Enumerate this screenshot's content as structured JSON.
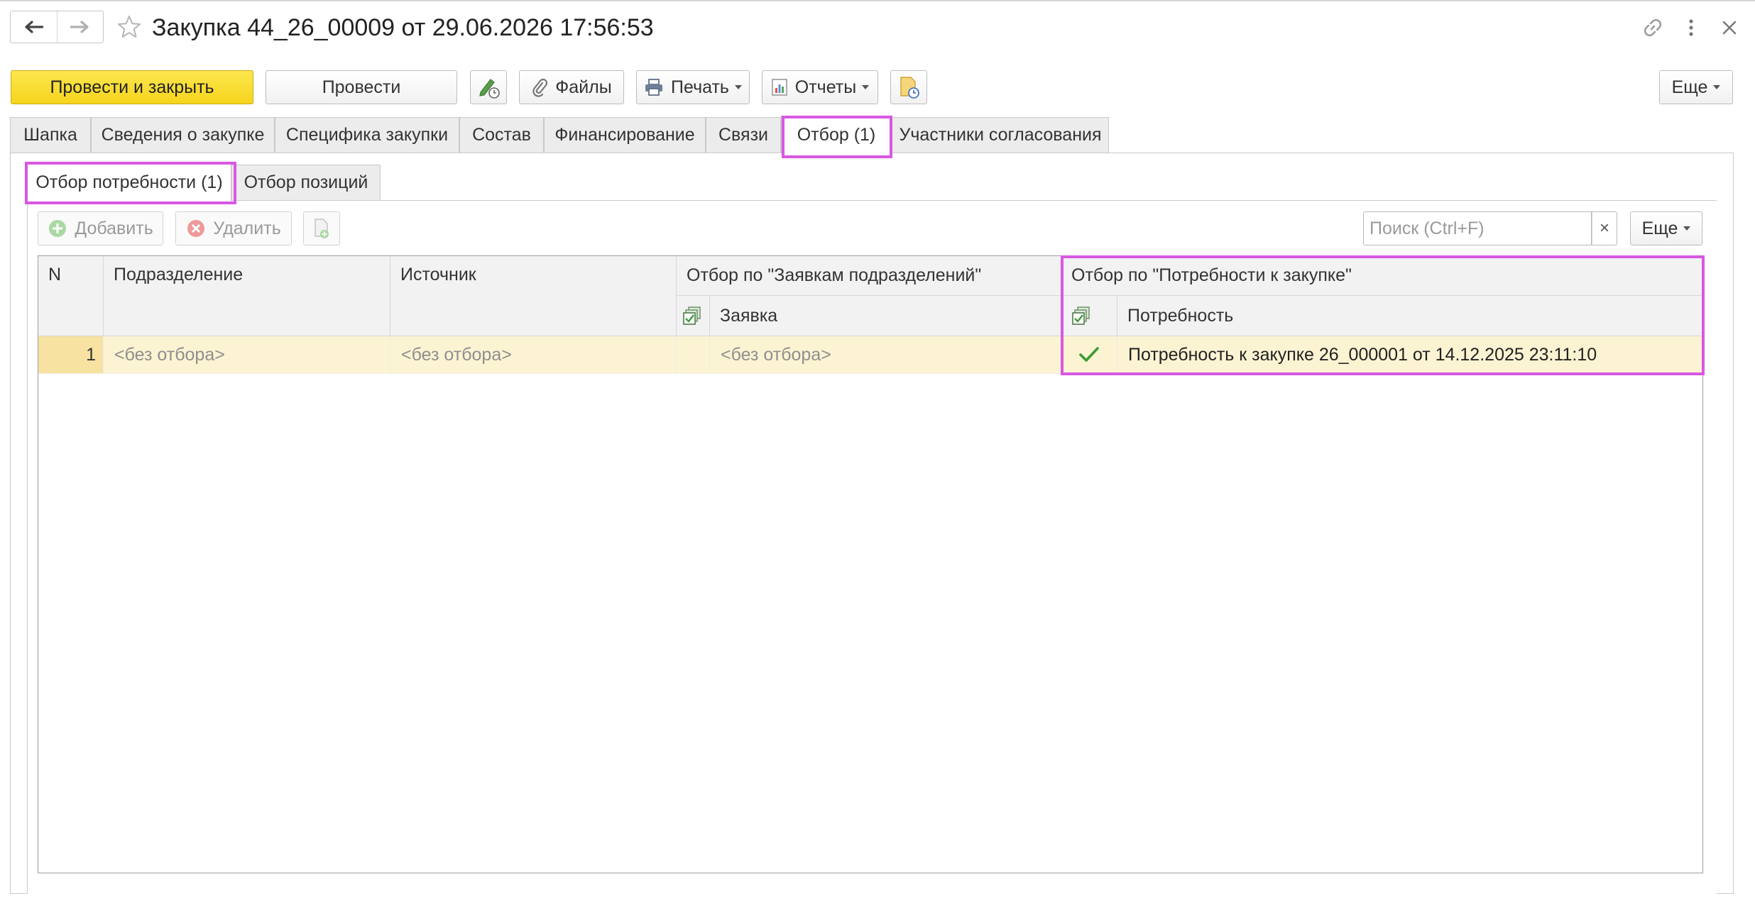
{
  "window": {
    "title": "Закупка 44_26_00009 от 29.06.2026 17:56:53",
    "icons": [
      "back-arrow-icon",
      "forward-arrow-icon",
      "favorite-star-icon",
      "link-icon",
      "more-vertical-icon",
      "close-icon"
    ]
  },
  "toolbar": {
    "post_and_close": "Провести и закрыть",
    "post": "Провести",
    "files": "Файлы",
    "print": "Печать",
    "reports": "Отчеты",
    "more": "Еще"
  },
  "tabs": [
    {
      "label": "Шапка"
    },
    {
      "label": "Сведения о закупке"
    },
    {
      "label": "Специфика закупки"
    },
    {
      "label": "Состав"
    },
    {
      "label": "Финансирование"
    },
    {
      "label": "Связи"
    },
    {
      "label": "Отбор (1)",
      "active": true
    },
    {
      "label": "Участники согласования"
    }
  ],
  "subtabs": [
    {
      "label": "Отбор потребности (1)",
      "active": true
    },
    {
      "label": "Отбор позиций"
    }
  ],
  "table_toolbar": {
    "add": "Добавить",
    "delete": "Удалить",
    "search_placeholder": "Поиск (Ctrl+F)",
    "clear": "×",
    "more": "Еще"
  },
  "table": {
    "headers": {
      "n": "N",
      "department": "Подразделение",
      "source": "Источник",
      "dept_requests_group": "Отбор по \"Заявкам подразделений\"",
      "request": "Заявка",
      "needs_group": "Отбор по \"Потребности к закупке\"",
      "need": "Потребность"
    },
    "rows": [
      {
        "n": "1",
        "department": "<без отбора>",
        "source": "<без отбора>",
        "request_checked": false,
        "request": "<без отбора>",
        "need_checked": true,
        "need": "Потребность к закупке 26_000001 от 14.12.2025 23:11:10"
      }
    ]
  },
  "colors": {
    "primary_button": "#f6d41c",
    "selected_row": "#fcf3d2",
    "highlight": "#d858e2",
    "check": "#3c9a35"
  }
}
